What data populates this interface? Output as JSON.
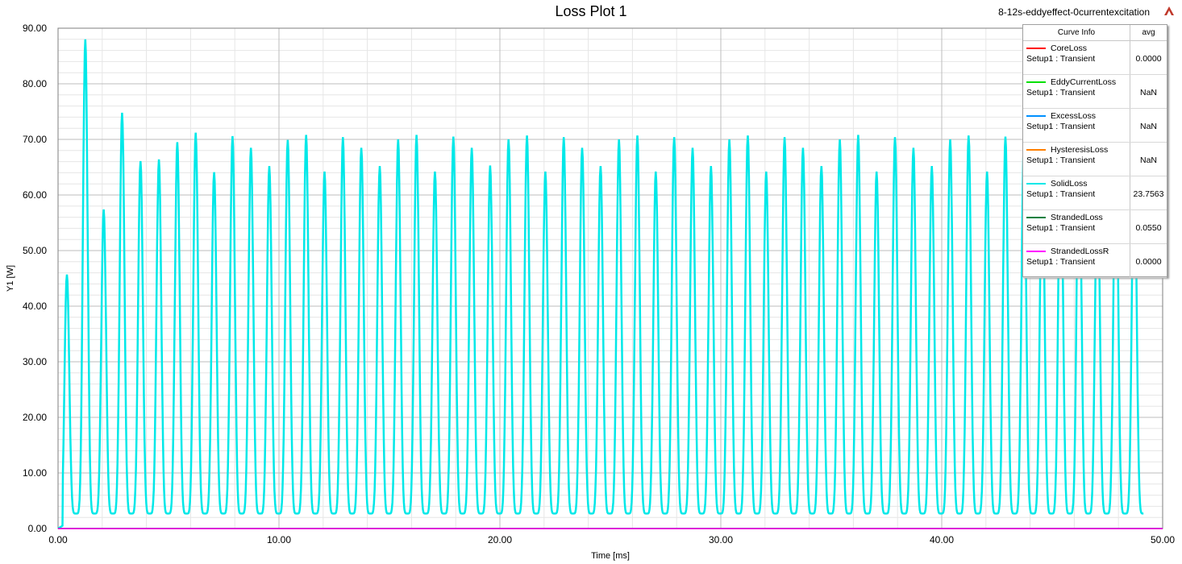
{
  "title": "Loss Plot 1",
  "project": "8-12s-eddyeffect-0currentexcitation",
  "logo_icon": "ansys-logo-icon",
  "chart_data": {
    "type": "line",
    "title": "Loss Plot 1",
    "xlabel": "Time [ms]",
    "ylabel": "Y1 [W]",
    "xlim": [
      0,
      50
    ],
    "ylim": [
      0,
      90
    ],
    "x_ticks": [
      "0.00",
      "10.00",
      "20.00",
      "30.00",
      "40.00",
      "50.00"
    ],
    "y_ticks": [
      "0.00",
      "10.00",
      "20.00",
      "30.00",
      "40.00",
      "50.00",
      "60.00",
      "70.00",
      "80.00",
      "90.00"
    ],
    "grid": true,
    "legend_placement": "top-right",
    "legend_headers": [
      "Curve Info",
      "avg"
    ],
    "series": [
      {
        "name": "CoreLoss",
        "setup": "Setup1 : Transient",
        "avg": "0.0000",
        "color": "#ff0000",
        "values": [
          [
            0,
            0
          ],
          [
            50,
            0
          ]
        ]
      },
      {
        "name": "EddyCurrentLoss",
        "setup": "Setup1 : Transient",
        "avg": "NaN",
        "color": "#00e000",
        "values": []
      },
      {
        "name": "ExcessLoss",
        "setup": "Setup1 : Transient",
        "avg": "NaN",
        "color": "#0090ff",
        "values": []
      },
      {
        "name": "HysteresisLoss",
        "setup": "Setup1 : Transient",
        "avg": "NaN",
        "color": "#ff8000",
        "values": []
      },
      {
        "name": "SolidLoss",
        "setup": "Setup1 : Transient",
        "avg": "23.7563",
        "color": "#00e8e8",
        "period_ms": 0.833,
        "start_ms": 0.4,
        "trough": 2.7,
        "peaks": [
          45.7,
          88.0,
          57.4,
          74.8,
          66.1,
          66.4,
          69.5,
          71.2,
          64.1,
          70.6,
          68.5,
          65.2,
          69.9,
          70.8,
          64.2,
          70.4,
          68.5,
          65.2,
          70.0,
          70.8,
          64.2,
          70.5,
          68.5,
          65.3,
          70.0,
          70.7,
          64.2,
          70.4,
          68.5,
          65.2,
          70.0,
          70.7,
          64.2,
          70.4,
          68.5,
          65.2,
          70.0,
          70.7,
          64.2,
          70.4,
          68.5,
          65.2,
          70.0,
          70.8,
          64.2,
          70.4,
          68.5,
          65.2,
          70.0,
          70.7,
          64.2,
          70.5,
          68.5,
          65.2,
          70.0,
          70.6,
          64.1,
          70.4,
          68.5
        ]
      },
      {
        "name": "StrandedLoss",
        "setup": "Setup1 : Transient",
        "avg": "0.0550",
        "color": "#008040",
        "values": [
          [
            0,
            0.05
          ],
          [
            50,
            0.05
          ]
        ]
      },
      {
        "name": "StrandedLossR",
        "setup": "Setup1 : Transient",
        "avg": "0.0000",
        "color": "#ff00ff",
        "values": [
          [
            0,
            0
          ],
          [
            50,
            0
          ]
        ]
      }
    ]
  }
}
